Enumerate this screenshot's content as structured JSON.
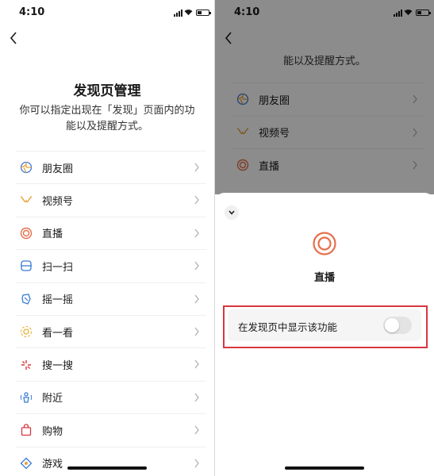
{
  "status": {
    "time": "4:10"
  },
  "left": {
    "title": "发现页管理",
    "description": "你可以指定出现在「发现」页面内的功能以及提醒方式。",
    "items": [
      {
        "label": "朋友圈",
        "icon": "moments-icon"
      },
      {
        "label": "视频号",
        "icon": "channels-icon"
      },
      {
        "label": "直播",
        "icon": "live-icon"
      },
      {
        "label": "扫一扫",
        "icon": "scan-icon"
      },
      {
        "label": "摇一摇",
        "icon": "shake-icon"
      },
      {
        "label": "看一看",
        "icon": "top-stories-icon"
      },
      {
        "label": "搜一搜",
        "icon": "search-icon"
      },
      {
        "label": "附近",
        "icon": "nearby-icon"
      },
      {
        "label": "购物",
        "icon": "shopping-icon"
      },
      {
        "label": "游戏",
        "icon": "games-icon"
      }
    ]
  },
  "right": {
    "description_tail": "能以及提醒方式。",
    "items": [
      {
        "label": "朋友圈"
      },
      {
        "label": "视频号"
      },
      {
        "label": "直播"
      }
    ],
    "sheet": {
      "title": "直播",
      "toggle_label": "在发现页中显示该功能",
      "toggle_on": false
    }
  },
  "colors": {
    "accent_red": "#d9363e",
    "live_orange": "#e5704c"
  }
}
